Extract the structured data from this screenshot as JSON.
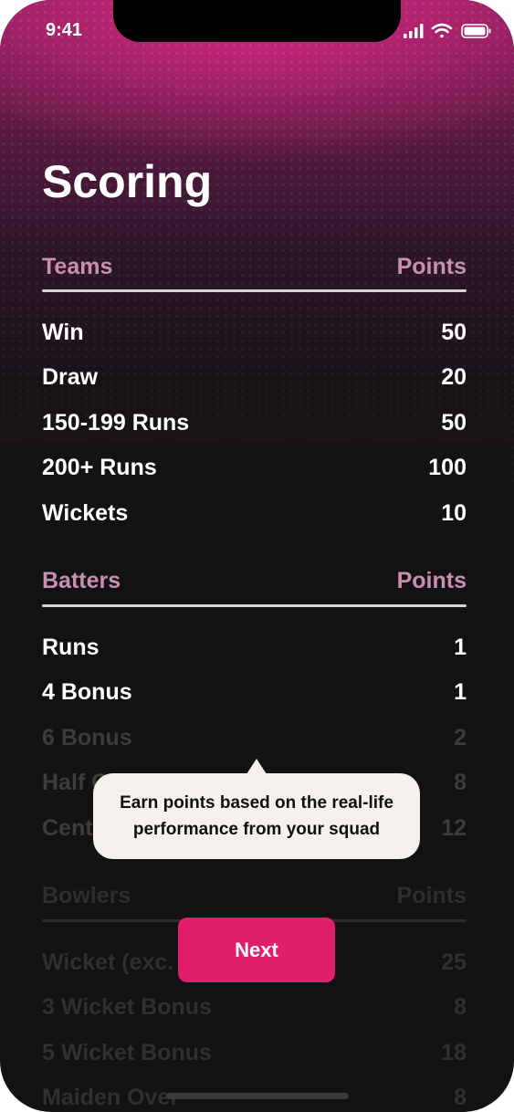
{
  "status_bar": {
    "time": "9:41"
  },
  "page": {
    "title": "Scoring"
  },
  "teams": {
    "header": "Teams",
    "points_header": "Points",
    "rows": [
      {
        "label": "Win",
        "points": "50"
      },
      {
        "label": "Draw",
        "points": "20"
      },
      {
        "label": "150-199 Runs",
        "points": "50"
      },
      {
        "label": "200+ Runs",
        "points": "100"
      },
      {
        "label": "Wickets",
        "points": "10"
      }
    ]
  },
  "batters": {
    "header": "Batters",
    "points_header": "Points",
    "rows": [
      {
        "label": "Runs",
        "points": "1"
      },
      {
        "label": "4 Bonus",
        "points": "1"
      },
      {
        "label": "6 Bonus",
        "points": "2"
      },
      {
        "label": "Half C",
        "points": "8"
      },
      {
        "label": "Cent",
        "points": "12"
      }
    ]
  },
  "bowlers": {
    "header": "Bowlers",
    "points_header": "Points",
    "rows": [
      {
        "label": "Wicket (exc.",
        "points": "25"
      },
      {
        "label": "3 Wicket Bonus",
        "points": "8"
      },
      {
        "label": "5 Wicket Bonus",
        "points": "18"
      },
      {
        "label": "Maiden Over",
        "points": "8"
      }
    ]
  },
  "tooltip": {
    "text": "Earn points based on the real-life performance from your squad"
  },
  "next_button": {
    "label": "Next"
  },
  "colors": {
    "accent": "#e01e6a",
    "section_header": "#c98fb0",
    "tooltip_bg": "#f5f1ec"
  }
}
